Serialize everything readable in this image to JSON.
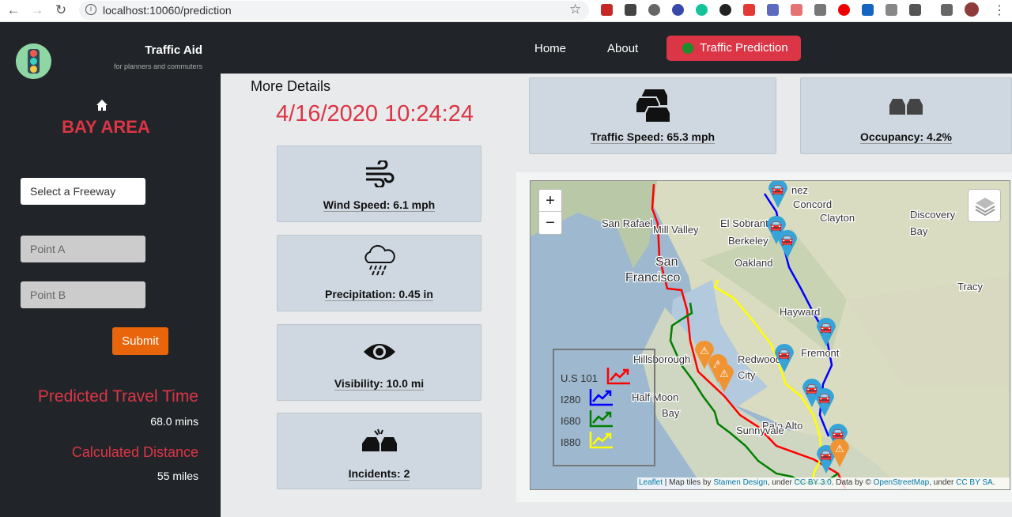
{
  "browser": {
    "url": "localhost:10060/prediction"
  },
  "brand": {
    "title": "Traffic Aid",
    "tagline": "for planners and commuters"
  },
  "sidebar": {
    "region": "BAY AREA",
    "freeway_placeholder": "Select a Freeway",
    "point_a_placeholder": "Point A",
    "point_b_placeholder": "Point B",
    "submit_label": "Submit",
    "travel_time_label": "Predicted Travel Time",
    "travel_time_value": "68.0 mins",
    "distance_label": "Calculated Distance",
    "distance_value": "55 miles"
  },
  "nav": {
    "home": "Home",
    "about": "About",
    "prediction": "Traffic Prediction",
    "prediction_color": "#dc3545"
  },
  "details": {
    "heading": "More Details",
    "datetime": "4/16/2020 10:24:24"
  },
  "cards": {
    "wind": "Wind Speed: 6.1 mph",
    "precip": "Precipitation: 0.45 in",
    "visibility": "Visibility: 10.0 mi",
    "incidents": "Incidents: 2",
    "speed": "Traffic Speed: 65.3 mph",
    "occupancy": "Occupancy: 4.2%"
  },
  "map": {
    "zoom_in": "+",
    "zoom_out": "−",
    "places": [
      "San Rafael",
      "Mill Valley",
      "San",
      "Francisco",
      "El Sobrant",
      "Berkeley",
      "Oakland",
      "Concord",
      "Clayton",
      "Discovery",
      "Bay",
      "Tracy",
      "Hayward",
      "Fremont",
      "Hillsborough",
      "Redwood",
      "City",
      "Half Moon",
      "Bay",
      "Palo Alto",
      "Sunnyvale",
      "nez"
    ],
    "legend": [
      {
        "label": "U.S 101",
        "color": "#ff0000"
      },
      {
        "label": "I280",
        "color": "#0000ff"
      },
      {
        "label": "I680",
        "color": "#008000"
      },
      {
        "label": "I880",
        "color": "#ffff00"
      }
    ],
    "attribution": {
      "leaflet": "Leaflet",
      "t1": " | Map tiles by ",
      "stamen": "Stamen Design",
      "t2": ", under ",
      "ccby": "CC BY 3.0",
      "t3": ". Data by © ",
      "osm": "OpenStreetMap",
      "t4": ", under ",
      "ccbysa": "CC BY SA",
      "t5": "."
    }
  }
}
